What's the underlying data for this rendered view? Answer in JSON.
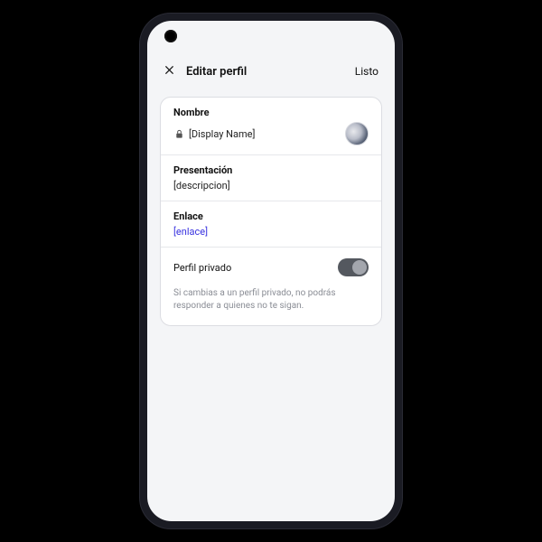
{
  "header": {
    "title": "Editar perfil",
    "done": "Listo"
  },
  "profile": {
    "name_label": "Nombre",
    "name_value": "[Display Name]",
    "bio_label": "Presentación",
    "bio_value": "[descripcion]",
    "link_label": "Enlace",
    "link_value": "[enlace]",
    "private_label": "Perfil privado",
    "private_note": "Si cambias a un perfil privado, no podrás responder a quienes no te sigan."
  }
}
